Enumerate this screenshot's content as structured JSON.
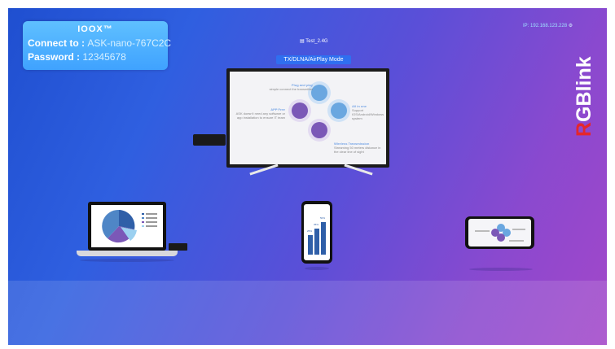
{
  "connection": {
    "logo": "IOOX™",
    "connect_label": "Connect to :",
    "connect_value": "ASK-nano-767C2C",
    "password_label": "Password :",
    "password_value": "12345678"
  },
  "network": {
    "wifi_name": "Test_2.4G",
    "ip_label": "IP:",
    "ip_value": "192.168.123.228"
  },
  "mode_label": "TX/DLNA/AirPlay Mode",
  "brand": {
    "letters": [
      "R",
      "G",
      "B",
      "link"
    ],
    "colors": {
      "r": "#e5262c",
      "g": "#ffffff",
      "b": "#ffffff",
      "link": "#ffffff"
    }
  },
  "tv_features": [
    {
      "title": "Plug and play",
      "text": "simple connect the transmitter"
    },
    {
      "title": "APP Free",
      "text": "ASK doesn't need any software or app installation to ensure IT team"
    },
    {
      "title": "All in one",
      "text": "Support IOS/Android/Windows system"
    },
    {
      "title": "Wireless Transmission",
      "text": "Streaming 50 meters distance in the clear line of sight"
    }
  ],
  "phone_chart_labels": [
    "25%",
    "35%",
    "50%"
  ],
  "colors": {
    "accent": "#2f6ff0",
    "purple": "#7b58b7",
    "blue_node": "#6aa7e0"
  }
}
